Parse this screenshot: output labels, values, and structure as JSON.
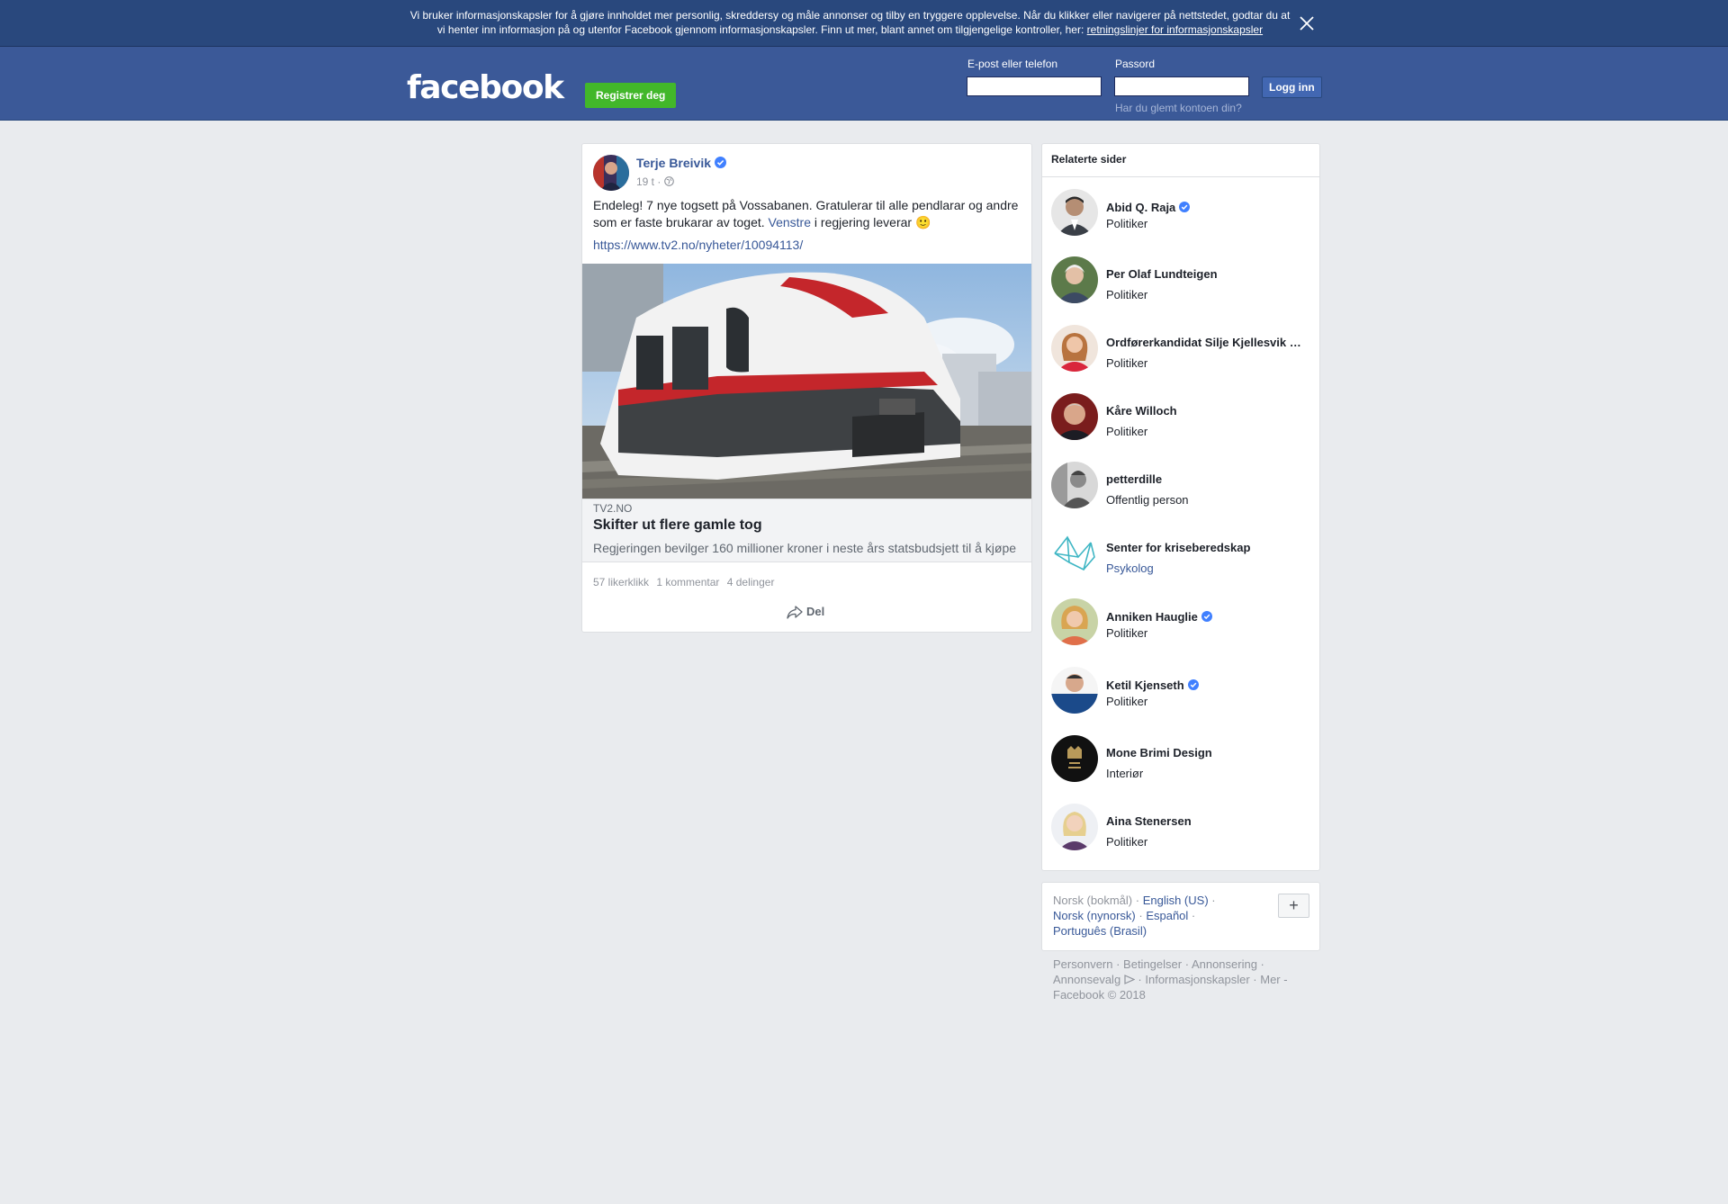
{
  "cookie_banner": {
    "text": "Vi bruker informasjonskapsler for å gjøre innholdet mer personlig, skreddersy og måle annonser og tilby en tryggere opplevelse. Når du klikker eller navigerer på nettstedet, godtar du at vi henter inn informasjon på og utenfor Facebook gjennom informasjonskapsler. Finn ut mer, blant annet om tilgjengelige kontroller, her: ",
    "link_text": "retningslinjer for informasjonskapsler",
    "close_icon": "close-icon"
  },
  "header": {
    "logo": "facebook",
    "register_label": "Registrer deg",
    "email_label": "E-post eller telefon",
    "password_label": "Passord",
    "login_label": "Logg inn",
    "forgot_label": "Har du glemt kontoen din?"
  },
  "post": {
    "author": "Terje Breivik",
    "time": "19 t",
    "meta_separator": " · ",
    "privacy_icon": "globe-icon",
    "text_before": "Endeleg! 7 nye togsett på Vossabanen. Gratulerar til alle pendlarar og andre som er faste brukarar av toget. ",
    "text_link": "Venstre",
    "text_after": " i regjering leverar ",
    "emoji": "🙂",
    "url": "https://www.tv2.no/nyheter/10094113/",
    "attachment": {
      "domain": "TV2.NO",
      "title": "Skifter ut flere gamle tog",
      "description": "Regjeringen bevilger 160 millioner kroner i neste års statsbudsjett til å kjøpe"
    },
    "likes": "57 likerklikk",
    "comments": "1 kommentar",
    "shares": "4 delinger",
    "share_label": "Del"
  },
  "related": {
    "title": "Relaterte sider",
    "pages": [
      {
        "name": "Abid Q. Raja",
        "category": "Politiker",
        "verified": true
      },
      {
        "name": "Per Olaf Lundteigen",
        "category": "Politiker",
        "verified": false
      },
      {
        "name": "Ordførerkandidat Silje Kjellesvik Olsen",
        "category": "Politiker",
        "verified": false
      },
      {
        "name": "Kåre Willoch",
        "category": "Politiker",
        "verified": false
      },
      {
        "name": "petterdille",
        "category": "Offentlig person",
        "verified": false
      },
      {
        "name": "Senter for kriseberedskap",
        "category": "Psykolog",
        "verified": false
      },
      {
        "name": "Anniken Hauglie",
        "category": "Politiker",
        "verified": true
      },
      {
        "name": "Ketil Kjenseth",
        "category": "Politiker",
        "verified": true
      },
      {
        "name": "Mone Brimi Design",
        "category": "Interiør",
        "verified": false
      },
      {
        "name": "Aina Stenersen",
        "category": "Politiker",
        "verified": false
      }
    ]
  },
  "languages": {
    "current": "Norsk (bokmål)",
    "english": "English (US)",
    "nynorsk": "Norsk (nynorsk)",
    "spanish": "Español",
    "portuguese": "Português (Brasil)",
    "plus": "+",
    "sep": " · "
  },
  "footer": {
    "privacy": "Personvern",
    "terms": "Betingelser",
    "advertising": "Annonsering",
    "ad_choices": "Annonsevalg",
    "cookies": "Informasjonskapsler",
    "more": "Mer",
    "sep": " · ",
    "more_sep": " - ",
    "copyright": "Facebook © 2018"
  }
}
